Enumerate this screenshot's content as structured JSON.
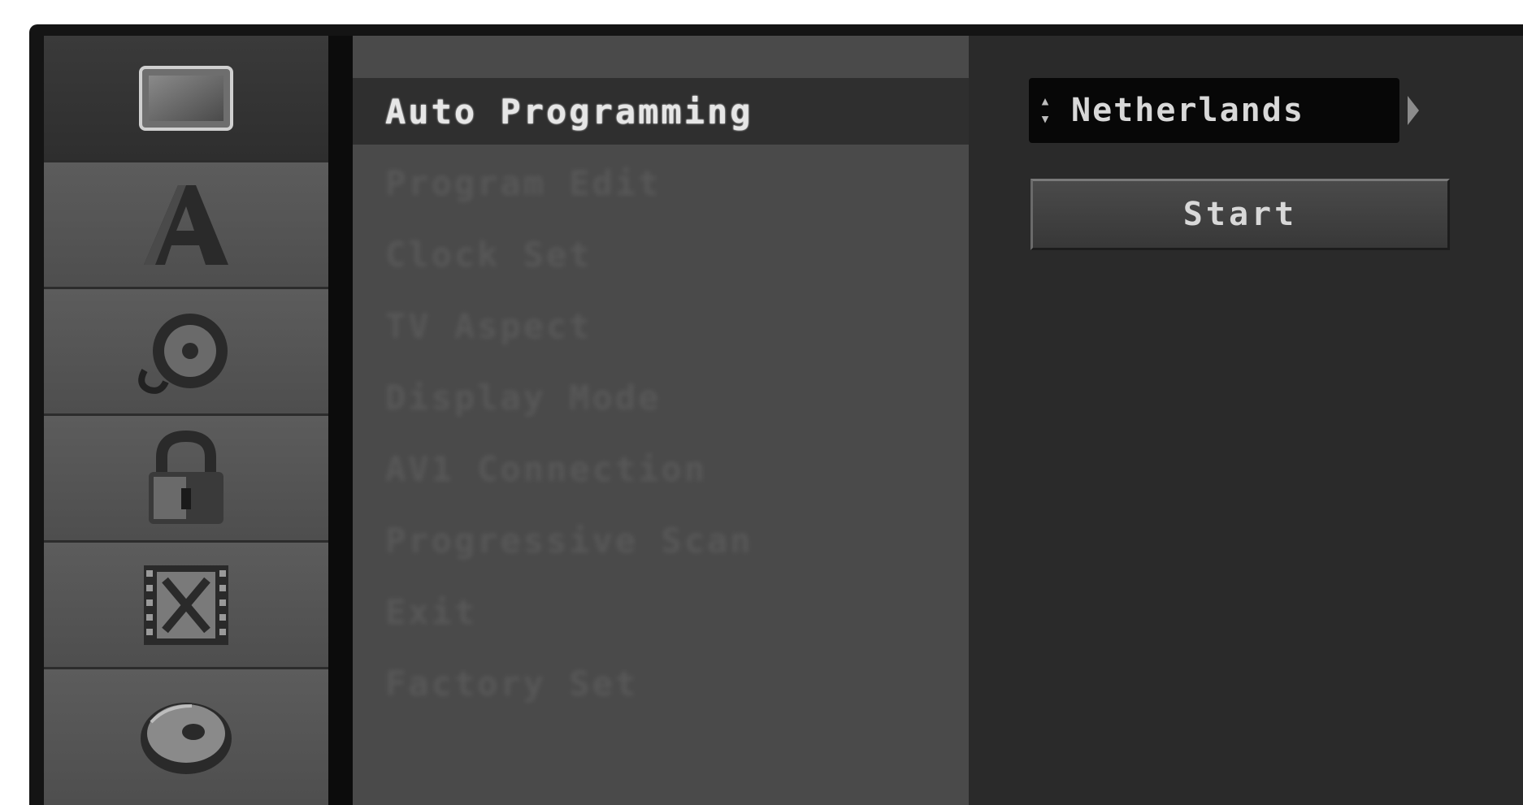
{
  "categories": [
    {
      "name": "General",
      "icon": "tv-screen-icon",
      "active": true
    },
    {
      "name": "Language",
      "icon": "letter-a-icon",
      "active": false
    },
    {
      "name": "Audio",
      "icon": "audio-disc-icon",
      "active": false
    },
    {
      "name": "Lock",
      "icon": "padlock-icon",
      "active": false
    },
    {
      "name": "Recording",
      "icon": "film-strip-icon",
      "active": false
    },
    {
      "name": "Disc",
      "icon": "disc-icon",
      "active": false
    }
  ],
  "menu": {
    "items": [
      {
        "label": "Auto Programming",
        "active": true
      },
      {
        "label": "Program Edit",
        "active": false
      },
      {
        "label": "Clock Set",
        "active": false
      },
      {
        "label": "TV Aspect",
        "active": false
      },
      {
        "label": "Display Mode",
        "active": false
      },
      {
        "label": "AV1 Connection",
        "active": false
      },
      {
        "label": "Progressive Scan",
        "active": false
      },
      {
        "label": "Exit",
        "active": false
      },
      {
        "label": "Factory Set",
        "active": false
      }
    ]
  },
  "options": {
    "country": "Netherlands",
    "start_label": "Start"
  }
}
